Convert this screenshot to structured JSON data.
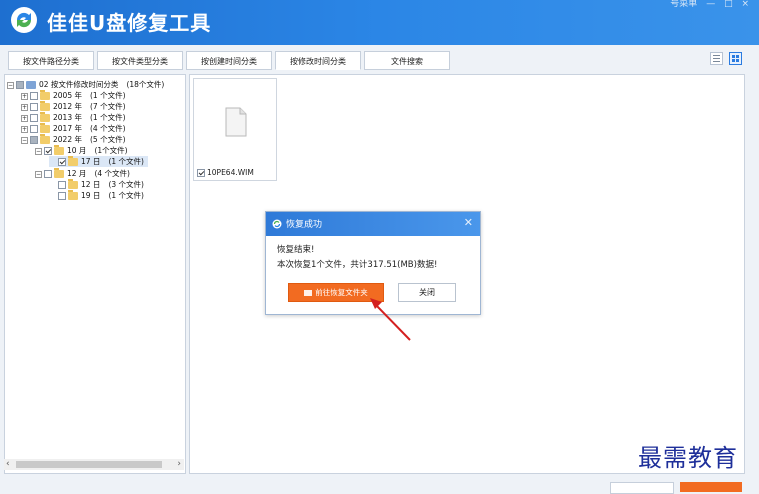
{
  "app": {
    "title": "佳佳U盘修复工具",
    "top_right": [
      "号菜单",
      "—",
      "□",
      "×"
    ]
  },
  "tabs": [
    {
      "label": "按文件路径分类"
    },
    {
      "label": "按文件类型分类"
    },
    {
      "label": "按创建时间分类"
    },
    {
      "label": "按修改时间分类",
      "active": true
    },
    {
      "label": "文件搜索"
    }
  ],
  "tree": [
    {
      "label": "02 按文件修改时间分类",
      "count": "(18个文件)"
    },
    {
      "label": "2005 年",
      "count": "(1 个文件)"
    },
    {
      "label": "2012 年",
      "count": "(7 个文件)"
    },
    {
      "label": "2013 年",
      "count": "(1 个文件)"
    },
    {
      "label": "2017 年",
      "count": "(4 个文件)"
    },
    {
      "label": "2022 年",
      "count": "(5 个文件)"
    },
    {
      "label": "10 月",
      "count": "(1个文件)"
    },
    {
      "label": "17 日",
      "count": "(1 个文件)"
    },
    {
      "label": "12 月",
      "count": "(4 个文件)"
    },
    {
      "label": "12 日",
      "count": "(3 个文件)"
    },
    {
      "label": "19 日",
      "count": "(1 个文件)"
    }
  ],
  "files": [
    {
      "name": "10PE64.WIM"
    }
  ],
  "dialog": {
    "title": "恢复成功",
    "line1": "恢复结束!",
    "line2": "本次恢复1个文件，共计317.51(MB)数据!",
    "open_button": "前往恢复文件夹",
    "close_button": "关闭"
  },
  "watermark": "最需教育",
  "colors": {
    "titlebar": "#2b86e6",
    "accent": "#f26b21"
  }
}
